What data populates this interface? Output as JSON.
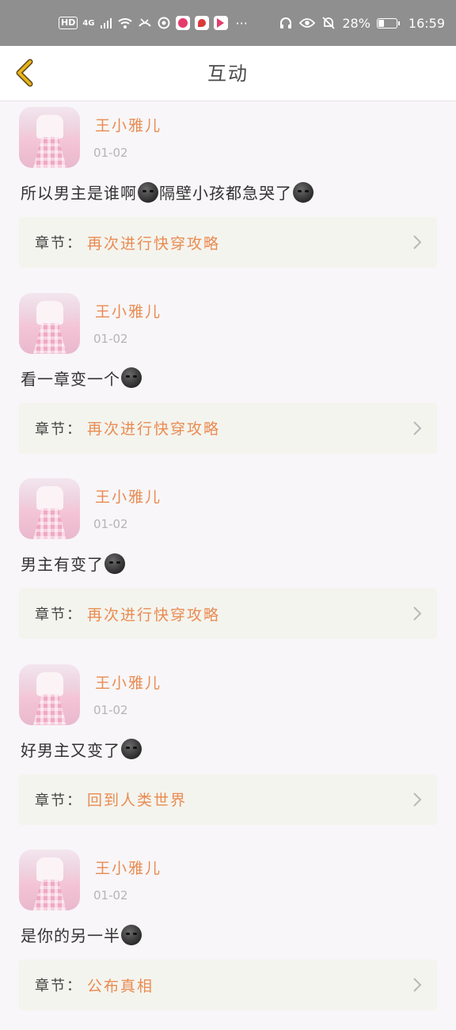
{
  "status_bar": {
    "hd": "HD",
    "network": "4G",
    "battery_percent": "28%",
    "battery_level": 0.28,
    "time": "16:59",
    "more": "···"
  },
  "header": {
    "title": "互动",
    "back_icon": "chevron-left-icon",
    "accent_color": "#e8b21a"
  },
  "comments": [
    {
      "username": "王小雅儿",
      "date": "01-02",
      "text": "所以男主是谁啊",
      "text2": "隔壁小孩都急哭了",
      "chapter_label": "章节：",
      "chapter": "再次进行快穿攻略"
    },
    {
      "username": "王小雅儿",
      "date": "01-02",
      "text": "看一章变一个",
      "chapter_label": "章节：",
      "chapter": "再次进行快穿攻略"
    },
    {
      "username": "王小雅儿",
      "date": "01-02",
      "text": "男主有变了",
      "chapter_label": "章节：",
      "chapter": "再次进行快穿攻略"
    },
    {
      "username": "王小雅儿",
      "date": "01-02",
      "text": "好男主又变了",
      "chapter_label": "章节：",
      "chapter": "回到人类世界"
    },
    {
      "username": "王小雅儿",
      "date": "01-02",
      "text": "是你的另一半",
      "chapter_label": "章节：",
      "chapter": "公布真相"
    }
  ],
  "colors": {
    "username": "#e98b52",
    "chapter_name": "#e98b52",
    "date": "#b5b5b5"
  }
}
